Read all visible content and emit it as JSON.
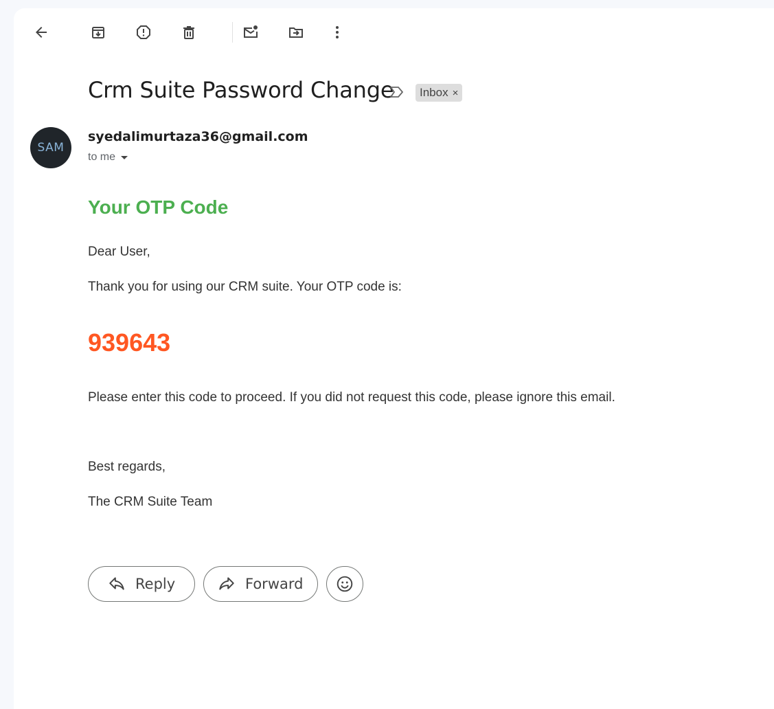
{
  "toolbar": {
    "icons": [
      "back-arrow-icon",
      "archive-icon",
      "report-spam-icon",
      "delete-icon",
      "mark-unread-icon",
      "move-to-icon",
      "more-vert-icon"
    ]
  },
  "email": {
    "subject": "Crm Suite Password Change",
    "label": "Inbox",
    "label_close": "×",
    "sender_initials": "SAM",
    "sender": "syedalimurtaza36@gmail.com",
    "recipient": "to me"
  },
  "body": {
    "heading": "Your OTP Code",
    "greeting": "Dear User,",
    "intro": "Thank you for using our CRM suite. Your OTP code is:",
    "otp": "939643",
    "instruction": "Please enter this code to proceed. If you did not request this code, please ignore this email.",
    "closing": "Best regards,",
    "signature": "The CRM Suite Team"
  },
  "actions": {
    "reply_label": "Reply",
    "forward_label": "Forward"
  },
  "colors": {
    "heading": "#4caf50",
    "otp": "#ff5722"
  }
}
